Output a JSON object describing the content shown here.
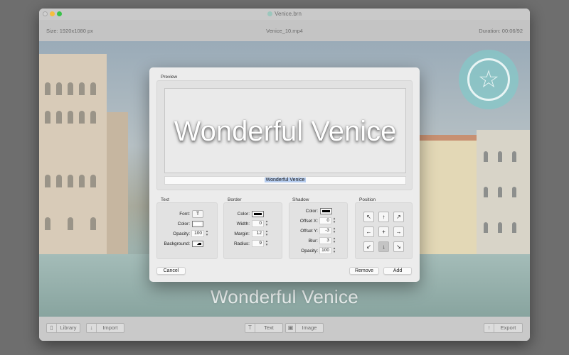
{
  "window": {
    "title": "Venice.brn",
    "icon": "app-document-icon"
  },
  "info": {
    "size": "Size:  1920x1080 px",
    "filename": "Venice_10.mp4",
    "duration": "Duration:  00:06/92"
  },
  "video": {
    "overlay_text": "Wonderful Venice",
    "watermark_icon": "star-icon"
  },
  "dialog": {
    "preview_label": "Preview",
    "preview_text": "Wonderful Venice",
    "text_input_value": "Wonderful Venice",
    "text_section": {
      "label": "Text",
      "font_label": "Font:",
      "font_icon": "T",
      "color_label": "Color:",
      "color_value": "#ffffff",
      "opacity_label": "Opacity:",
      "opacity_value": "100",
      "background_label": "Background:"
    },
    "border_section": {
      "label": "Border",
      "color_label": "Color:",
      "color_value": "#000000",
      "width_label": "Width:",
      "width_value": "0",
      "margin_label": "Margin:",
      "margin_value": "12",
      "radius_label": "Radius:",
      "radius_value": "9"
    },
    "shadow_section": {
      "label": "Shadow",
      "color_label": "Color:",
      "color_value": "#000000",
      "offset_x_label": "Offset X:",
      "offset_x_value": "0",
      "offset_y_label": "Offset Y:",
      "offset_y_value": "-3",
      "blur_label": "Blur:",
      "blur_value": "3",
      "opacity_label": "Opacity:",
      "opacity_value": "100"
    },
    "position_section": {
      "label": "Position",
      "buttons": [
        "↖",
        "↑",
        "↗",
        "←",
        "+",
        "→",
        "↙",
        "↓",
        "↘"
      ],
      "selected": "↓"
    },
    "buttons": {
      "cancel": "Cancel",
      "remove": "Remove",
      "add": "Add"
    }
  },
  "bottom": {
    "library": "Library",
    "import": "Import",
    "text": "Text",
    "image": "Image",
    "export": "Export"
  },
  "icons": {
    "library": "▯",
    "import": "↓",
    "text": "T",
    "image": "▣",
    "export": "↑"
  }
}
